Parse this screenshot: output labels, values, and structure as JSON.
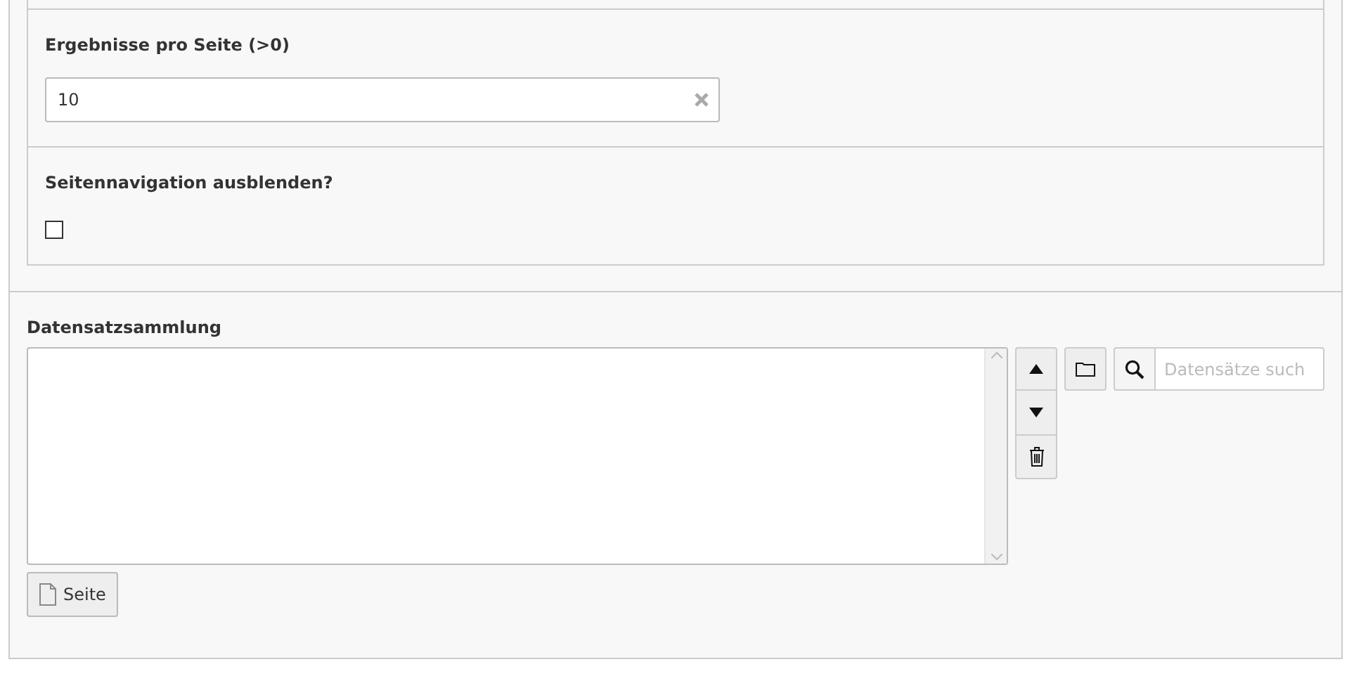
{
  "results_per_page": {
    "label": "Ergebnisse pro Seite (>0)",
    "value": "10"
  },
  "hide_pagination": {
    "label": "Seitennavigation ausblenden?",
    "checked": false
  },
  "record_collection": {
    "label": "Datensatzsammlung",
    "search_placeholder": "Datensätze such",
    "add_button": "Seite"
  }
}
